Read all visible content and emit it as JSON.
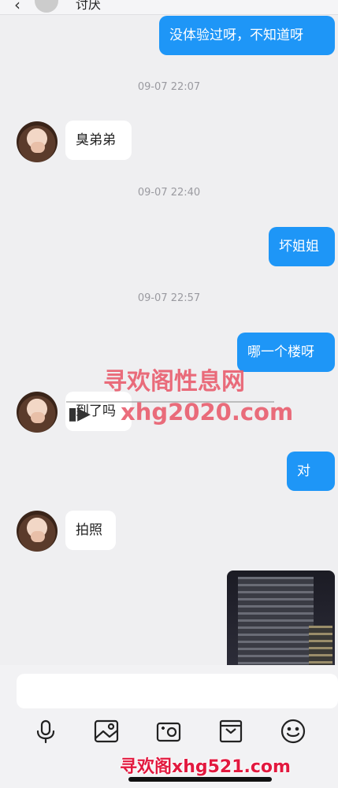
{
  "header": {
    "title": "讨厌"
  },
  "messages": [
    {
      "text": "没体验过呀，不知道呀"
    },
    {
      "text": "09-07 22:07"
    },
    {
      "text": "臭弟弟"
    },
    {
      "text": "09-07 22:40"
    },
    {
      "text": "坏姐姐"
    },
    {
      "text": "09-07 22:57"
    },
    {
      "text": "哪一个楼呀"
    },
    {
      "text": "到了吗"
    },
    {
      "text": "对"
    },
    {
      "text": "拍照"
    }
  ],
  "watermarks": {
    "line1": "寻欢阁性息网",
    "line2": "xhg2020.com",
    "line3": "寻欢阁xhg521.com"
  },
  "toolbar": {
    "icons": [
      "microphone-icon",
      "image-icon",
      "camera-icon",
      "wallet-icon",
      "emoji-icon"
    ]
  },
  "colors": {
    "outgoing_bubble": "#1e96f7",
    "incoming_bubble": "#ffffff",
    "background": "#efeff1"
  }
}
